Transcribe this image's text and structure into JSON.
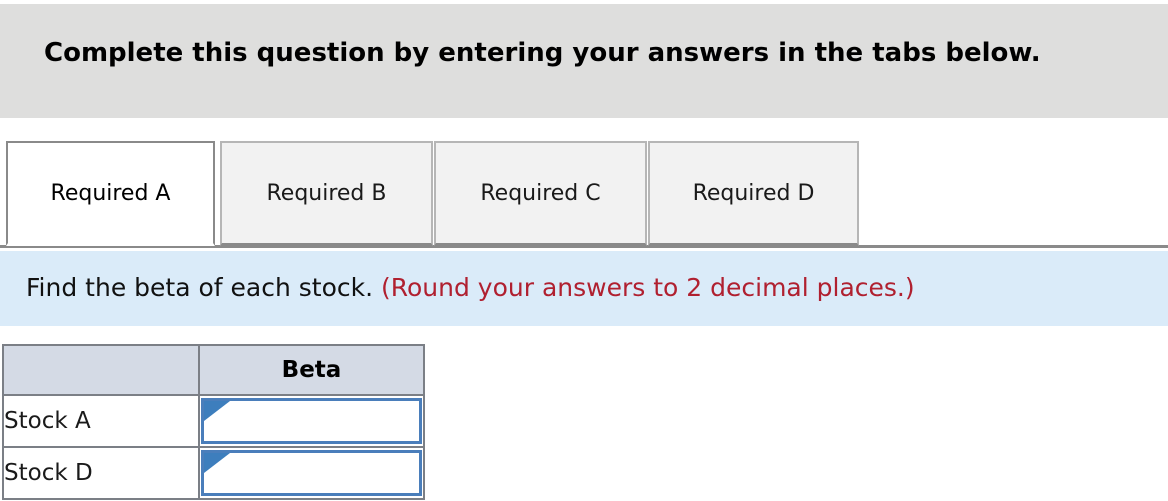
{
  "banner": {
    "title": "Complete this question by entering your answers in the tabs below."
  },
  "tabs": {
    "items": [
      {
        "label": "Required A",
        "active": true
      },
      {
        "label": "Required B",
        "active": false
      },
      {
        "label": "Required C",
        "active": false
      },
      {
        "label": "Required D",
        "active": false
      }
    ]
  },
  "prompt": {
    "main": "Find the beta of each stock.",
    "note": "(Round your answers to 2 decimal places.)"
  },
  "table": {
    "columns": [
      "",
      "Beta"
    ],
    "rows": [
      {
        "label": "Stock A",
        "value": ""
      },
      {
        "label": "Stock D",
        "value": ""
      }
    ]
  },
  "colors": {
    "banner_bg": "#dededd",
    "prompt_bg": "#daebf9",
    "note_text": "#b02030",
    "table_header_bg": "#d4dae5",
    "input_border": "#4a7ebb",
    "marker": "#3d7ebd"
  }
}
